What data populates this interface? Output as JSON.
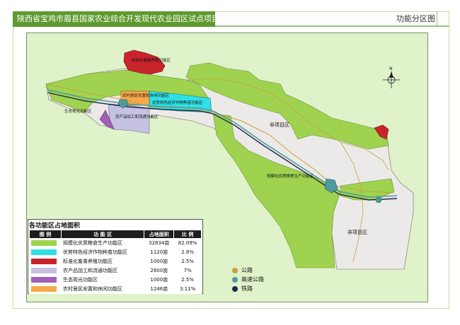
{
  "header": {
    "title": "陕西省宝鸡市眉县国家农业综合开发现代农业园区试点项目",
    "map_type": "功能分区图"
  },
  "map": {
    "labels": {
      "breeding": "标准化畜禽养殖功能区",
      "resettlement": "农村居民安置和休闲功能区",
      "seedling": "优势特色经济作物种苗功能区",
      "eco": "生态观光功能区",
      "processing": "农产品加工和流通功能区",
      "grain": "规模化优质粮食生产功能区",
      "non_project_1": "非项目区",
      "non_project_2": "非项目区"
    },
    "colors": {
      "grain": "#9fd34f",
      "seedling": "#2fe0e6",
      "breeding": "#c8242c",
      "processing": "#c4c2e0",
      "eco": "#a25fb4",
      "resettlement": "#f7a94a",
      "non_project": "#eceae9",
      "highway": "#4f9a9c",
      "road": "#c9a13a",
      "railway": "#1b2a4a",
      "background": "#dff2c9"
    }
  },
  "legend": {
    "title": "各功能区占地面积",
    "headers": [
      "图  例",
      "功  能  区",
      "占地面积",
      "比  例"
    ],
    "rows": [
      {
        "color": "#9fd34f",
        "name": "规模化优质粮食生产功能区",
        "area": "32834亩",
        "ratio": "82.09%"
      },
      {
        "color": "#2fe0e6",
        "name": "优势特色经济作物种苗功能区",
        "area": "1120亩",
        "ratio": "2.8%"
      },
      {
        "color": "#c8242c",
        "name": "标准化畜禽养殖功能区",
        "area": "1000亩",
        "ratio": "2.5%"
      },
      {
        "color": "#c4c2e0",
        "name": "农产品加工和流通功能区",
        "area": "2800亩",
        "ratio": "7%"
      },
      {
        "color": "#a25fb4",
        "name": "生态观光功能区",
        "area": "1000亩",
        "ratio": "2.5%"
      },
      {
        "color": "#f7a94a",
        "name": "农村居民安置和休闲功能区",
        "area": "1246亩",
        "ratio": "3.11%"
      }
    ]
  },
  "line_legend": [
    {
      "color": "#c9a13a",
      "label": "公路"
    },
    {
      "color": "#4f9a9c",
      "label": "高速公路"
    },
    {
      "color": "#1b2a4a",
      "label": "铁路"
    }
  ],
  "compass": {
    "label": "N"
  }
}
